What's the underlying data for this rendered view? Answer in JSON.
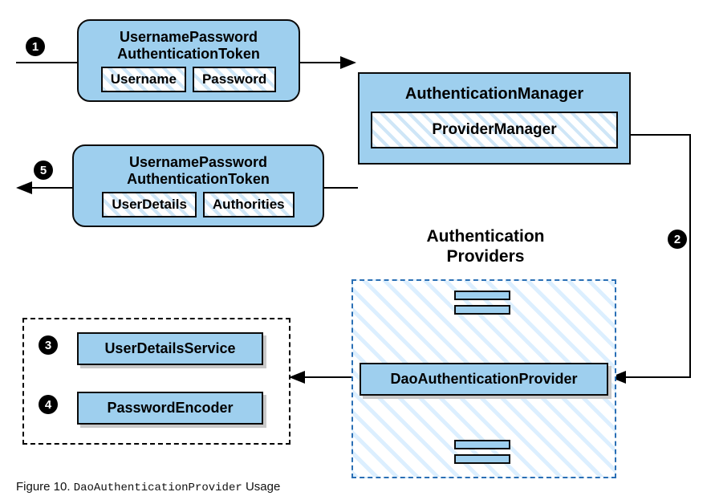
{
  "diagram": {
    "token1": {
      "title_line1": "UsernamePassword",
      "title_line2": "AuthenticationToken",
      "field1": "Username",
      "field2": "Password"
    },
    "token5": {
      "title_line1": "UsernamePassword",
      "title_line2": "AuthenticationToken",
      "field1": "UserDetails",
      "field2": "Authorities"
    },
    "auth_manager": {
      "title": "AuthenticationManager",
      "inner": "ProviderManager"
    },
    "providers_group_label_line1": "Authentication",
    "providers_group_label_line2": "Providers",
    "dao_provider": "DaoAuthenticationProvider",
    "services": {
      "uds": "UserDetailsService",
      "pe": "PasswordEncoder"
    },
    "badges": {
      "b1": "1",
      "b2": "2",
      "b3": "3",
      "b4": "4",
      "b5": "5"
    },
    "caption_prefix": "Figure 10. ",
    "caption_code": "DaoAuthenticationProvider",
    "caption_suffix": " Usage"
  }
}
